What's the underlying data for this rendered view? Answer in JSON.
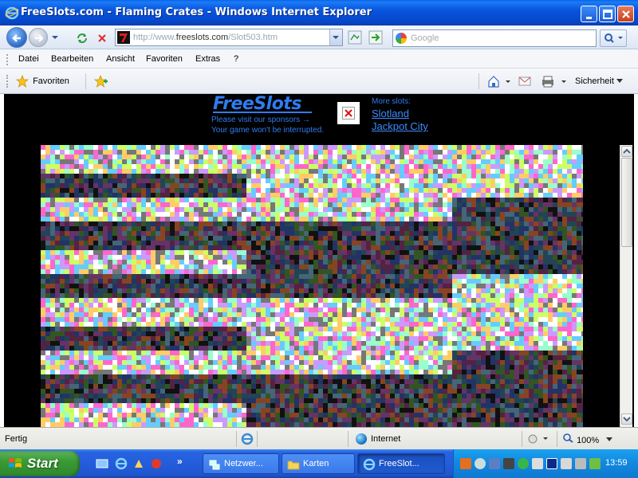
{
  "window": {
    "title": "FreeSlots.com - Flaming Crates - Windows Internet Explorer"
  },
  "address_bar": {
    "url_prefix": "http://www.",
    "url_host": "freeslots.com",
    "url_path": "/Slot503.htm",
    "search_placeholder": "Google"
  },
  "menu": {
    "items": [
      "Datei",
      "Bearbeiten",
      "Ansicht",
      "Favoriten",
      "Extras",
      "?"
    ]
  },
  "favorites_bar": {
    "favorites_label": "Favoriten",
    "security_label": "Sicherheit"
  },
  "page": {
    "logo_text": "FreeSlots",
    "sponsor_line": "Please visit our sponsors →",
    "sponsor_sub": "Your game won't be interrupted.",
    "more_slots_label": "More slots:",
    "links": [
      "Slotland",
      "Jackpot City"
    ]
  },
  "status_bar": {
    "status": "Fertig",
    "zone": "Internet",
    "zoom": "100%"
  },
  "taskbar": {
    "start_label": "Start",
    "tasks": [
      {
        "label": "Netzwer...",
        "icon": "network-icon",
        "active": false
      },
      {
        "label": "Karten",
        "icon": "folder-icon",
        "active": false
      },
      {
        "label": "FreeSlot...",
        "icon": "ie-icon",
        "active": true
      }
    ],
    "clock": "13:59"
  },
  "colors": {
    "accent_blue": "#2f7cf0",
    "link_blue": "#3c8cff",
    "taskbar_blue": "#245ddb",
    "start_green": "#3a9b36"
  }
}
